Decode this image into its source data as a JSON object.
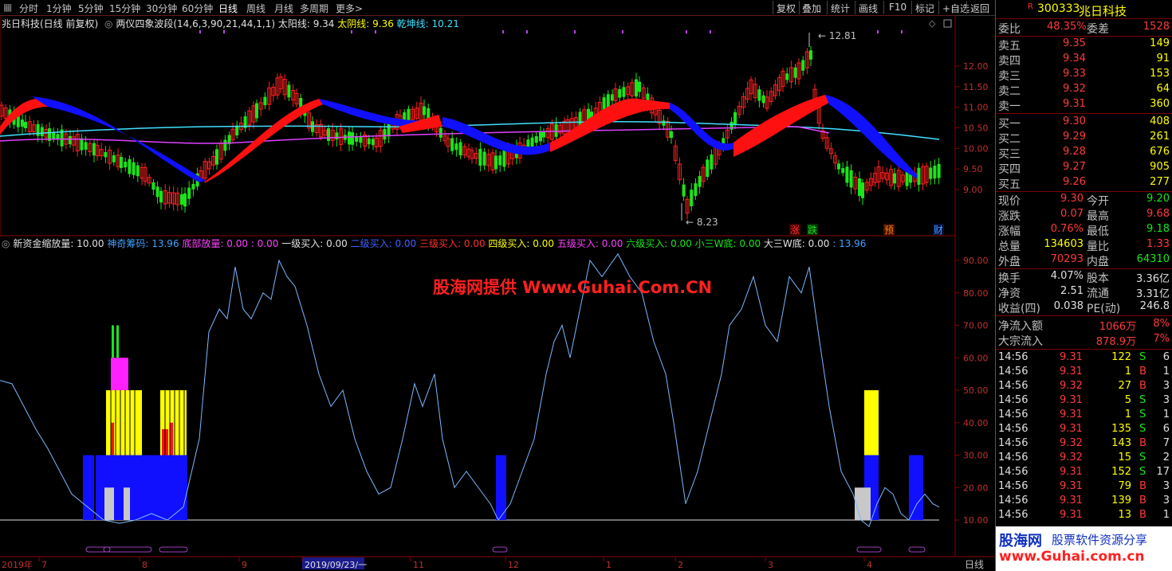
{
  "toolbar": {
    "left_items": [
      "分时",
      "1分钟",
      "5分钟",
      "15分钟",
      "30分钟",
      "60分钟",
      "日线",
      "周线",
      "月线",
      "多周期",
      "更多>"
    ],
    "active": "日线",
    "right_items": [
      "复权",
      "叠加",
      "统计",
      "画线",
      "F10",
      "标记",
      "+自选",
      "返回"
    ]
  },
  "main_chart": {
    "title": "兆日科技(日线 前复权)",
    "indicator": "两仪四象波段(14,6,3,90,21,44,1,1)",
    "lines": [
      {
        "label": "太阳线:",
        "value": "9.34",
        "color": "#e0e0e0"
      },
      {
        "label": "太阴线:",
        "value": "9.36",
        "color": "#ffff00"
      },
      {
        "label": "乾坤线:",
        "value": "10.21",
        "color": "#40e0ff"
      }
    ],
    "high_label": "12.81",
    "low_label": "8.23",
    "y_ticks": [
      "12.00",
      "11.50",
      "11.00",
      "10.50",
      "10.00",
      "9.50",
      "9.00"
    ],
    "markers": [
      "涨",
      "跌",
      "预",
      "财"
    ]
  },
  "sub_chart": {
    "title": "新资金缩放量",
    "items": [
      {
        "label": "新资金缩放量",
        "value": ": 10.00",
        "color": "#e0e0e0"
      },
      {
        "label": "神奇筹码:",
        "value": " 13.96",
        "color": "#40a0ff"
      },
      {
        "label": "底部放量:",
        "value": " 0.00",
        "color": "#ff40ff"
      },
      {
        "label": "",
        "value": ": 0.00",
        "color": "#ff40ff"
      },
      {
        "label": "一级买入:",
        "value": " 0.00",
        "color": "#e0e0e0"
      },
      {
        "label": "二级买入:",
        "value": " 0.00",
        "color": "#4060ff"
      },
      {
        "label": "三级买入:",
        "value": " 0.00",
        "color": "#ff3030"
      },
      {
        "label": "四级买入:",
        "value": " 0.00",
        "color": "#ffff00"
      },
      {
        "label": "五级买入:",
        "value": " 0.00",
        "color": "#ff40ff"
      },
      {
        "label": "六级买入:",
        "value": " 0.00",
        "color": "#19e619"
      },
      {
        "label": "小三W底:",
        "value": " 0.00",
        "color": "#19e619"
      },
      {
        "label": "大三W底:",
        "value": " 0.00",
        "color": "#e0e0e0"
      },
      {
        "label": "",
        "value": ": 13.96",
        "color": "#40a0ff"
      }
    ],
    "y_ticks": [
      "90.00",
      "80.00",
      "70.00",
      "60.00",
      "50.00",
      "40.00",
      "30.00",
      "20.00",
      "10.00"
    ]
  },
  "watermark": "股海网提供 Www.Guhai.Com.CN",
  "x_axis": {
    "labels": [
      "2019年",
      "7",
      "8",
      "9",
      "2019/09/23/一",
      "11",
      "12",
      "1",
      "2",
      "3",
      "4"
    ],
    "period": "日线"
  },
  "panel": {
    "code": "300333",
    "name": "兆日科技",
    "r_flag": "R",
    "weibi": {
      "label1": "委比",
      "value1": "48.35%",
      "label2": "委差",
      "value2": "1528"
    },
    "sells": [
      {
        "label": "卖五",
        "price": "9.35",
        "vol": "149"
      },
      {
        "label": "卖四",
        "price": "9.34",
        "vol": "91"
      },
      {
        "label": "卖三",
        "price": "9.33",
        "vol": "153"
      },
      {
        "label": "卖二",
        "price": "9.32",
        "vol": "64"
      },
      {
        "label": "卖一",
        "price": "9.31",
        "vol": "360"
      }
    ],
    "buys": [
      {
        "label": "买一",
        "price": "9.30",
        "vol": "408"
      },
      {
        "label": "买二",
        "price": "9.29",
        "vol": "261"
      },
      {
        "label": "买三",
        "price": "9.28",
        "vol": "676"
      },
      {
        "label": "买四",
        "price": "9.27",
        "vol": "905"
      },
      {
        "label": "买五",
        "price": "9.26",
        "vol": "277"
      }
    ],
    "stats": [
      {
        "l1": "现价",
        "v1": "9.30",
        "c1": "red",
        "l2": "今开",
        "v2": "9.20",
        "c2": "grn"
      },
      {
        "l1": "涨跌",
        "v1": "0.07",
        "c1": "red",
        "l2": "最高",
        "v2": "9.68",
        "c2": "red"
      },
      {
        "l1": "涨幅",
        "v1": "0.76%",
        "c1": "red",
        "l2": "最低",
        "v2": "9.18",
        "c2": "grn"
      },
      {
        "l1": "总量",
        "v1": "134603",
        "c1": "yel",
        "l2": "量比",
        "v2": "1.33",
        "c2": "red"
      },
      {
        "l1": "外盘",
        "v1": "70293",
        "c1": "red",
        "l2": "内盘",
        "v2": "64310",
        "c2": "grn"
      }
    ],
    "stats2": [
      {
        "l1": "换手",
        "v1": "4.07%",
        "l2": "股本",
        "v2": "3.36亿"
      },
      {
        "l1": "净资",
        "v1": "2.51",
        "l2": "流通",
        "v2": "3.31亿"
      },
      {
        "l1": "收益(四)",
        "v1": "0.038",
        "l2": "PE(动)",
        "v2": "246.8"
      }
    ],
    "flows": [
      {
        "label": "净流入额",
        "value": "1066万",
        "pct": "8%"
      },
      {
        "label": "大宗流入",
        "value": "878.9万",
        "pct": "7%"
      }
    ],
    "ticks": [
      {
        "time": "14:56",
        "price": "9.31",
        "vol": "122",
        "bs": "S",
        "n": "6"
      },
      {
        "time": "14:56",
        "price": "9.31",
        "vol": "1",
        "bs": "B",
        "n": "1"
      },
      {
        "time": "14:56",
        "price": "9.32",
        "vol": "27",
        "bs": "B",
        "n": "3"
      },
      {
        "time": "14:56",
        "price": "9.31",
        "vol": "5",
        "bs": "S",
        "n": "3"
      },
      {
        "time": "14:56",
        "price": "9.31",
        "vol": "1",
        "bs": "S",
        "n": "1"
      },
      {
        "time": "14:56",
        "price": "9.31",
        "vol": "135",
        "bs": "S",
        "n": "6"
      },
      {
        "time": "14:56",
        "price": "9.32",
        "vol": "143",
        "bs": "B",
        "n": "7"
      },
      {
        "time": "14:56",
        "price": "9.32",
        "vol": "15",
        "bs": "S",
        "n": "2"
      },
      {
        "time": "14:56",
        "price": "9.31",
        "vol": "152",
        "bs": "S",
        "n": "17"
      },
      {
        "time": "14:56",
        "price": "9.31",
        "vol": "79",
        "bs": "B",
        "n": "3"
      },
      {
        "time": "14:56",
        "price": "9.31",
        "vol": "139",
        "bs": "B",
        "n": "3"
      },
      {
        "time": "14:56",
        "price": "9.31",
        "vol": "13",
        "bs": "B",
        "n": "1"
      }
    ],
    "ad_brand": "股海网",
    "ad_text": "股票软件资源分享",
    "ad_url": "www.Guhai.com.cn"
  }
}
